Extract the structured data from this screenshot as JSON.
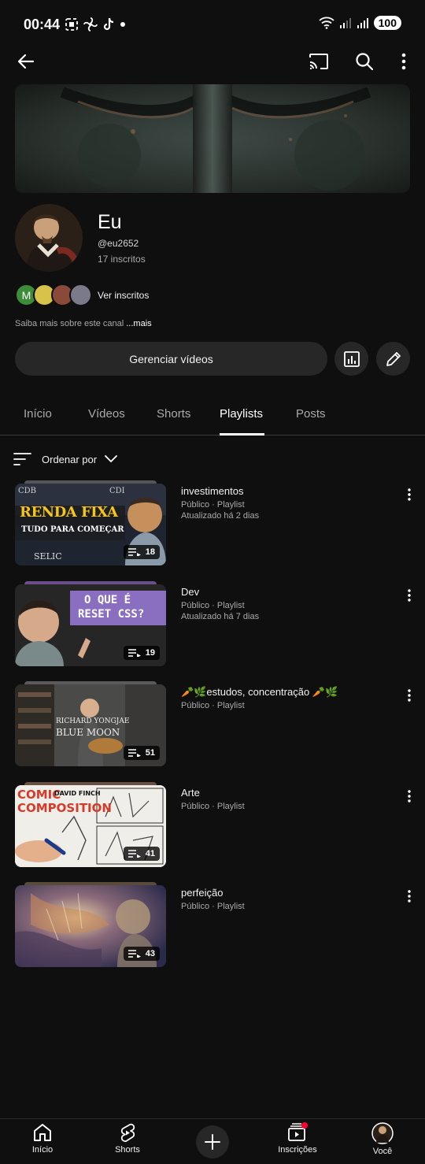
{
  "status": {
    "time": "00:44",
    "battery": "100"
  },
  "channel": {
    "name": "Eu",
    "handle": "@eu2652",
    "subscribers": "17 inscritos",
    "avatar_letter": "M",
    "ver_inscritos": "Ver inscritos",
    "about_text": "Saiba mais sobre este canal",
    "about_more": "...mais",
    "manage_label": "Gerenciar vídeos"
  },
  "tabs": [
    {
      "label": "Início"
    },
    {
      "label": "Vídeos"
    },
    {
      "label": "Shorts"
    },
    {
      "label": "Playlists"
    },
    {
      "label": "Posts"
    }
  ],
  "active_tab": "Playlists",
  "sort": {
    "label": "Ordenar por"
  },
  "playlists": [
    {
      "title": "investimentos",
      "meta": "Público · Playlist",
      "updated": "Atualizado há 2 dias",
      "count": "18",
      "thumb_texts": [
        "RENDA FIXA",
        "TUDO PARA COMEÇAR",
        "SELIC",
        "CDB",
        "CDI"
      ]
    },
    {
      "title": "Dev",
      "meta": "Público · Playlist",
      "updated": "Atualizado há 7 dias",
      "count": "19",
      "thumb_texts": [
        "O QUE É",
        "RESET CSS?"
      ]
    },
    {
      "title": "🥕🌿estudos, concentração 🥕🌿",
      "meta": "Público · Playlist",
      "updated": "",
      "count": "51",
      "thumb_texts": [
        "RICHARD YONGJAE",
        "BLUE MOON"
      ]
    },
    {
      "title": "Arte",
      "meta": "Público · Playlist",
      "updated": "",
      "count": "41",
      "thumb_texts": [
        "COMIC",
        "COMPOSITION",
        "DAVID FINCH"
      ]
    },
    {
      "title": "perfeição",
      "meta": "Público · Playlist",
      "updated": "",
      "count": "43",
      "thumb_texts": []
    }
  ],
  "nav": [
    {
      "label": "Início"
    },
    {
      "label": "Shorts"
    },
    {
      "label": "Inscrições"
    },
    {
      "label": "Você"
    }
  ],
  "colors": {
    "background": "#0f0f0f",
    "surface": "#272727",
    "text": "#f1f1f1",
    "secondary": "#aaaaaa",
    "notification": "#ff0033"
  }
}
